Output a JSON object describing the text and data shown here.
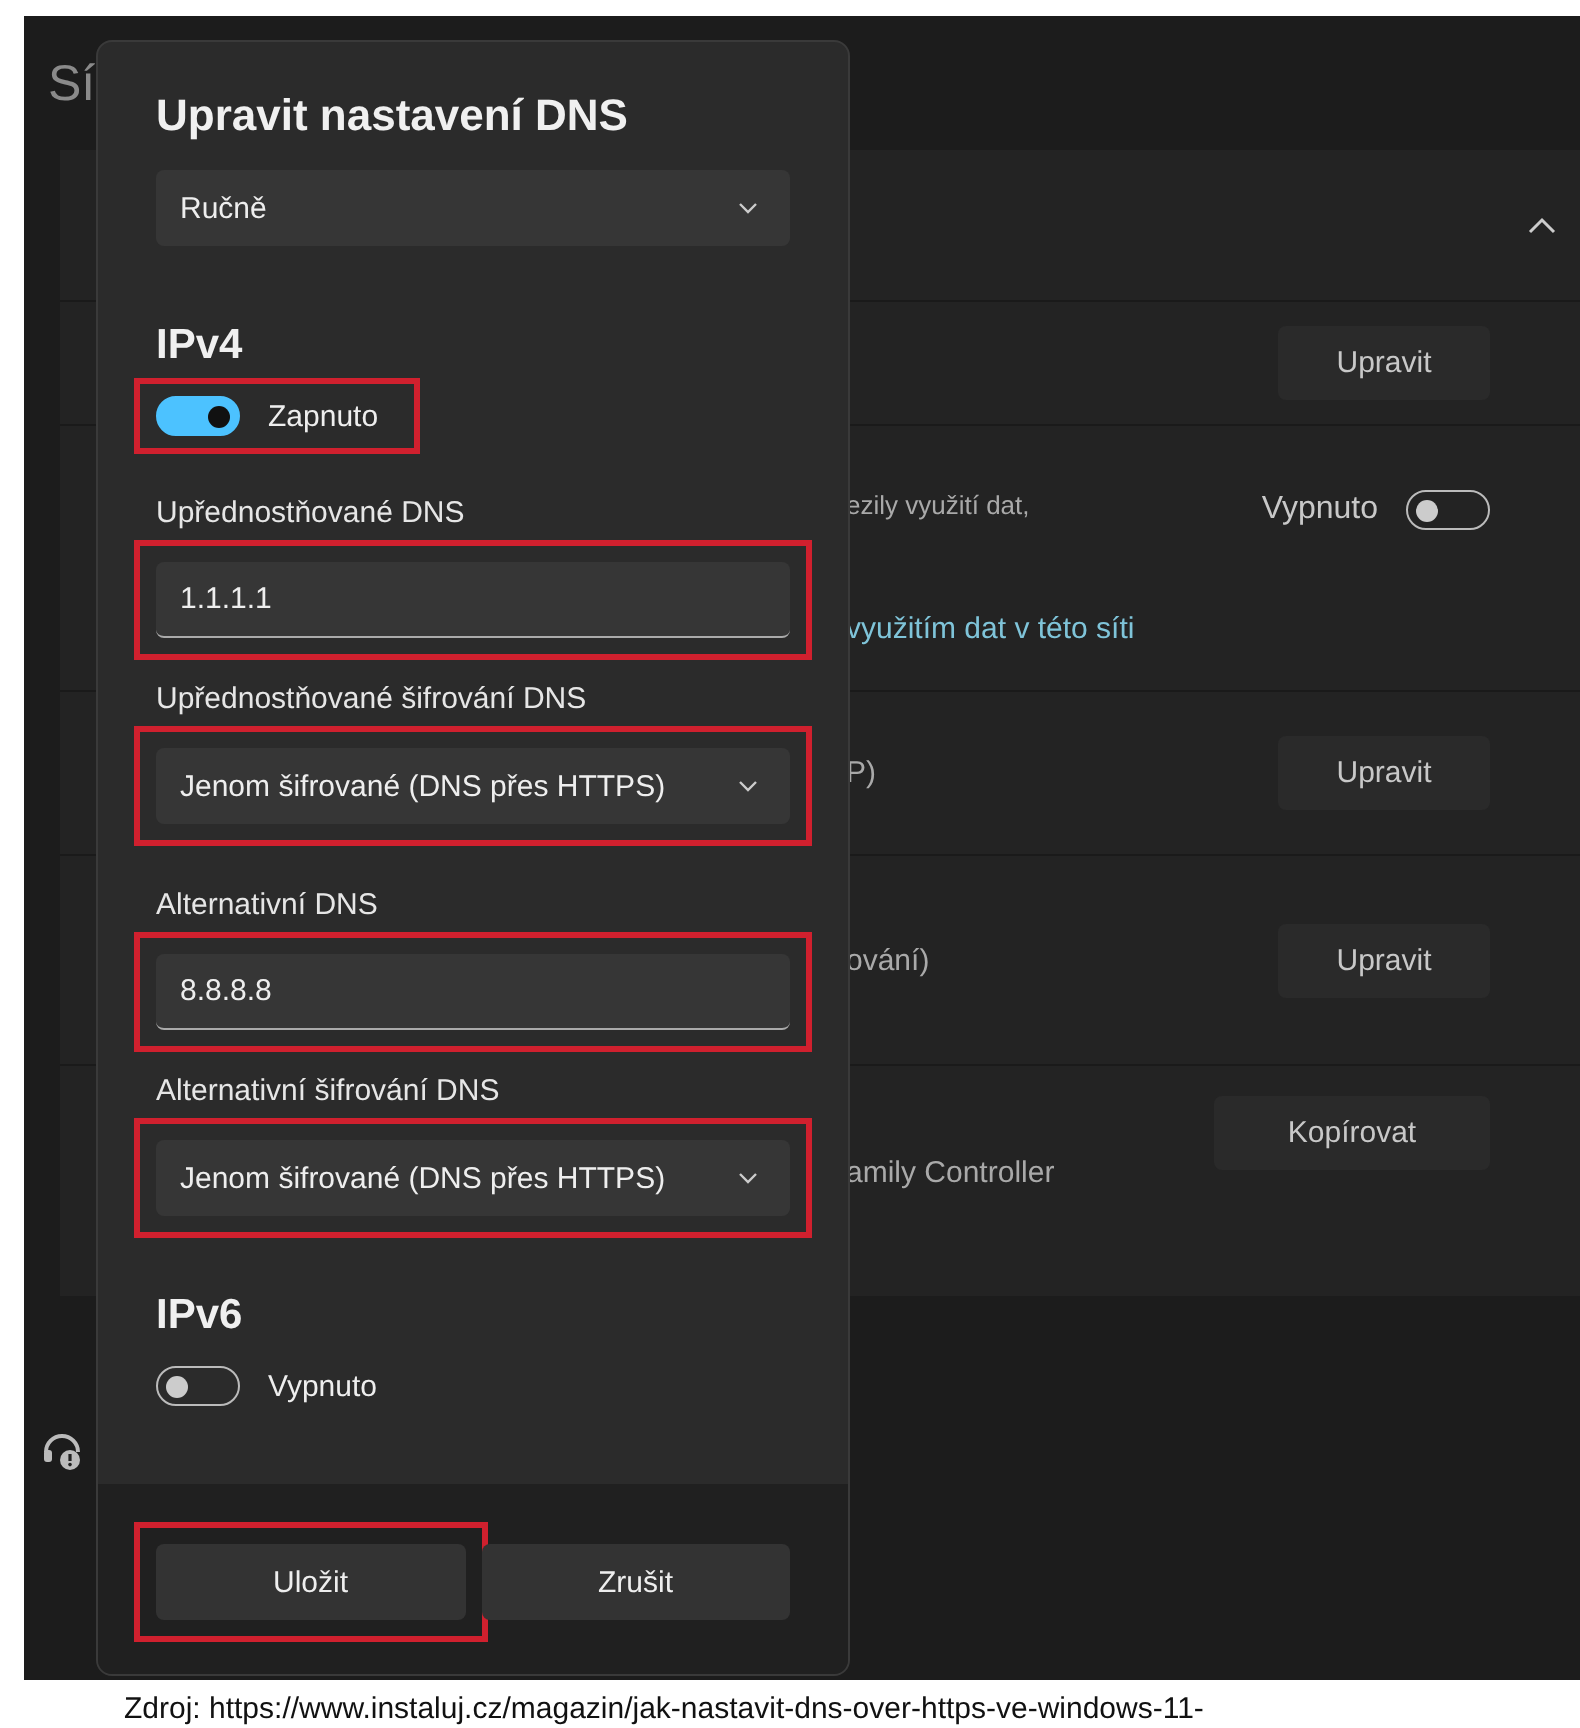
{
  "background": {
    "title": "Sí",
    "rows": [
      {
        "kind": "chevron",
        "expanded": true
      },
      {
        "kind": "button",
        "button": "Upravit"
      },
      {
        "kind": "toggle",
        "text": "ezily využití dat,",
        "state_label": "Vypnuto",
        "on": false,
        "link": "využitím dat v této síti"
      },
      {
        "kind": "button",
        "text": "P)",
        "button": "Upravit"
      },
      {
        "kind": "button",
        "text": "ování)",
        "button": "Upravit"
      },
      {
        "kind": "copy",
        "button": "Kopírovat",
        "subtext": "amily Controller"
      }
    ]
  },
  "dialog": {
    "title": "Upravit nastavení DNS",
    "mode": "Ručně",
    "sections": [
      {
        "heading": "IPv4",
        "toggle": {
          "on": true,
          "label": "Zapnuto",
          "highlighted": true
        },
        "groups": [
          [
            {
              "label": "Upřednostňované DNS",
              "kind": "input",
              "value": "1.1.1.1",
              "highlighted": true
            },
            {
              "label": "Upřednostňované šifrování DNS",
              "kind": "select",
              "value": "Jenom šifrované (DNS přes HTTPS)",
              "highlighted": true
            }
          ],
          [
            {
              "label": "Alternativní DNS",
              "kind": "input",
              "value": "8.8.8.8",
              "highlighted": true
            },
            {
              "label": "Alternativní šifrování DNS",
              "kind": "select",
              "value": "Jenom šifrované (DNS přes HTTPS)",
              "highlighted": true
            }
          ]
        ]
      },
      {
        "heading": "IPv6",
        "toggle": {
          "on": false,
          "label": "Vypnuto",
          "highlighted": false
        }
      }
    ],
    "buttons": [
      {
        "label": "Uložit",
        "highlighted": true
      },
      {
        "label": "Zrušit",
        "highlighted": false
      }
    ]
  },
  "caption": "Zdroj: https://www.instaluj.cz/magazin/jak-nastavit-dns-over-https-ve-windows-11-"
}
